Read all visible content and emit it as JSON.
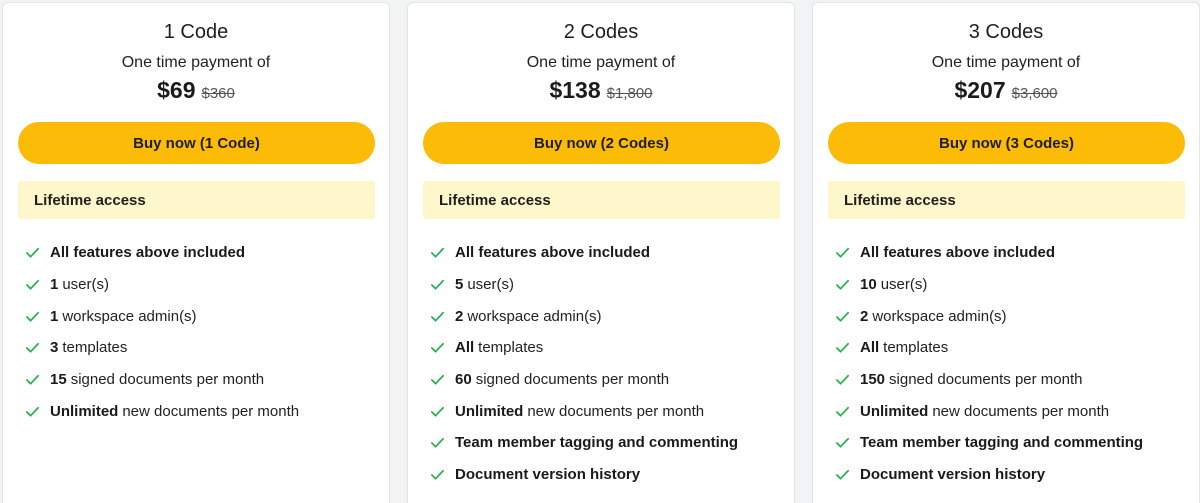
{
  "colors": {
    "button": "#fbbb06",
    "access_bg": "#fff7cc",
    "check": "#22b14c"
  },
  "plans": [
    {
      "title": "1 Code",
      "subtitle": "One time payment of",
      "price": "$69",
      "old_price": "$360",
      "button_label": "Buy now (1 Code)",
      "access_label": "Lifetime access",
      "features": [
        {
          "bold": "All features above included",
          "rest": ""
        },
        {
          "bold": "1",
          "rest": "user(s)"
        },
        {
          "bold": "1",
          "rest": "workspace admin(s)"
        },
        {
          "bold": "3",
          "rest": "templates"
        },
        {
          "bold": "15",
          "rest": "signed documents per month"
        },
        {
          "bold": "Unlimited",
          "rest": "new documents per month"
        }
      ]
    },
    {
      "title": "2 Codes",
      "subtitle": "One time payment of",
      "price": "$138",
      "old_price": "$1,800",
      "button_label": "Buy now (2 Codes)",
      "access_label": "Lifetime access",
      "features": [
        {
          "bold": "All features above included",
          "rest": ""
        },
        {
          "bold": "5",
          "rest": "user(s)"
        },
        {
          "bold": "2",
          "rest": "workspace admin(s)"
        },
        {
          "bold": "All",
          "rest": "templates"
        },
        {
          "bold": "60",
          "rest": "signed documents per month"
        },
        {
          "bold": "Unlimited",
          "rest": "new documents per month"
        },
        {
          "bold": "Team member tagging and commenting",
          "rest": ""
        },
        {
          "bold": "Document version history",
          "rest": ""
        }
      ]
    },
    {
      "title": "3 Codes",
      "subtitle": "One time payment of",
      "price": "$207",
      "old_price": "$3,600",
      "button_label": "Buy now (3 Codes)",
      "access_label": "Lifetime access",
      "features": [
        {
          "bold": "All features above included",
          "rest": ""
        },
        {
          "bold": "10",
          "rest": "user(s)"
        },
        {
          "bold": "2",
          "rest": "workspace admin(s)"
        },
        {
          "bold": "All",
          "rest": "templates"
        },
        {
          "bold": "150",
          "rest": "signed documents per month"
        },
        {
          "bold": "Unlimited",
          "rest": "new documents per month"
        },
        {
          "bold": "Team member tagging and commenting",
          "rest": ""
        },
        {
          "bold": "Document version history",
          "rest": ""
        }
      ]
    }
  ]
}
